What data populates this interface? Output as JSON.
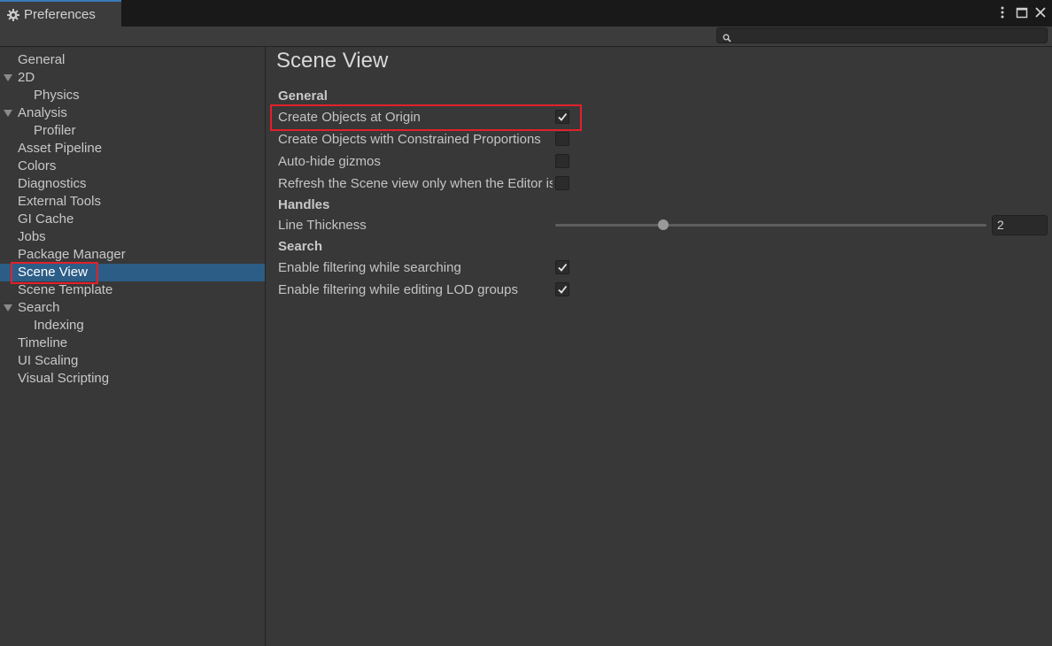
{
  "window": {
    "tab_title": "Preferences"
  },
  "search": {
    "value": "",
    "placeholder": ""
  },
  "sidebar": {
    "items": [
      {
        "label": "General",
        "indent": 0,
        "expandable": false,
        "selected": false
      },
      {
        "label": "2D",
        "indent": 0,
        "expandable": true,
        "selected": false
      },
      {
        "label": "Physics",
        "indent": 1,
        "expandable": false,
        "selected": false
      },
      {
        "label": "Analysis",
        "indent": 0,
        "expandable": true,
        "selected": false
      },
      {
        "label": "Profiler",
        "indent": 1,
        "expandable": false,
        "selected": false
      },
      {
        "label": "Asset Pipeline",
        "indent": 0,
        "expandable": false,
        "selected": false
      },
      {
        "label": "Colors",
        "indent": 0,
        "expandable": false,
        "selected": false
      },
      {
        "label": "Diagnostics",
        "indent": 0,
        "expandable": false,
        "selected": false
      },
      {
        "label": "External Tools",
        "indent": 0,
        "expandable": false,
        "selected": false
      },
      {
        "label": "GI Cache",
        "indent": 0,
        "expandable": false,
        "selected": false
      },
      {
        "label": "Jobs",
        "indent": 0,
        "expandable": false,
        "selected": false
      },
      {
        "label": "Package Manager",
        "indent": 0,
        "expandable": false,
        "selected": false
      },
      {
        "label": "Scene View",
        "indent": 0,
        "expandable": false,
        "selected": true
      },
      {
        "label": "Scene Template",
        "indent": 0,
        "expandable": false,
        "selected": false
      },
      {
        "label": "Search",
        "indent": 0,
        "expandable": true,
        "selected": false
      },
      {
        "label": "Indexing",
        "indent": 1,
        "expandable": false,
        "selected": false
      },
      {
        "label": "Timeline",
        "indent": 0,
        "expandable": false,
        "selected": false
      },
      {
        "label": "UI Scaling",
        "indent": 0,
        "expandable": false,
        "selected": false
      },
      {
        "label": "Visual Scripting",
        "indent": 0,
        "expandable": false,
        "selected": false
      }
    ]
  },
  "main": {
    "title": "Scene View",
    "sections": {
      "general": {
        "heading": "General",
        "create_origin": {
          "label": "Create Objects at Origin",
          "checked": true
        },
        "constrained": {
          "label": "Create Objects with Constrained Proportions",
          "checked": false
        },
        "autohide": {
          "label": "Auto-hide gizmos",
          "checked": false
        },
        "refresh": {
          "label": "Refresh the Scene view only when the Editor is in focus",
          "checked": false
        }
      },
      "handles": {
        "heading": "Handles",
        "line_thickness": {
          "label": "Line Thickness",
          "value": "2",
          "min": 1,
          "max": 5,
          "level": 2
        }
      },
      "search": {
        "heading": "Search",
        "filter_search": {
          "label": "Enable filtering while searching",
          "checked": true
        },
        "filter_lod": {
          "label": "Enable filtering while editing LOD groups",
          "checked": true
        }
      }
    }
  },
  "colors": {
    "accent_selection": "#2c5d87",
    "highlight_outline": "#e3202a"
  }
}
